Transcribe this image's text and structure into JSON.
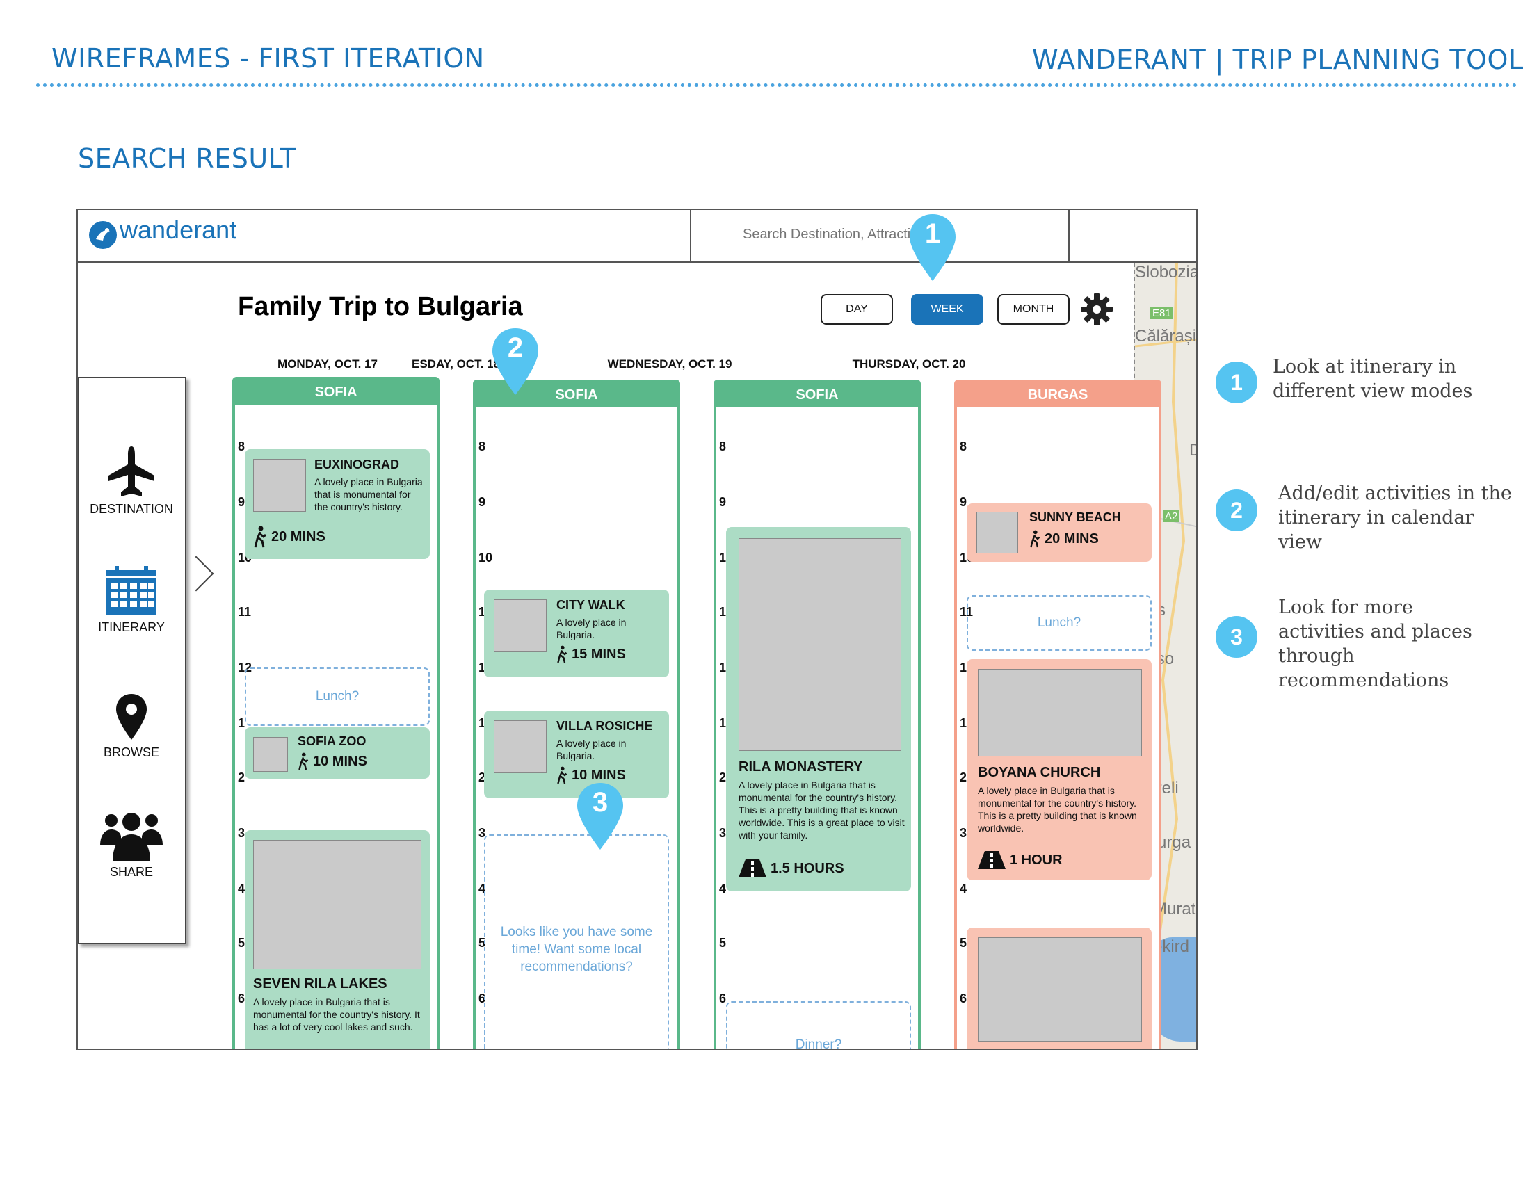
{
  "page": {
    "left_title": "WIREFRAMES - FIRST ITERATION",
    "right_title": "WANDERANT | TRIP PLANNING TOOL",
    "section_title": "SEARCH RESULT"
  },
  "app": {
    "logo_text": "wanderant",
    "search_placeholder": "Search Destination, Attraction, etc."
  },
  "trip": {
    "title": "Family Trip to Bulgaria"
  },
  "view_modes": [
    {
      "label": "DAY",
      "active": false
    },
    {
      "label": "WEEK",
      "active": true
    },
    {
      "label": "MONTH",
      "active": false
    }
  ],
  "sidebar": {
    "items": [
      {
        "label": "DESTINATION",
        "icon": "airplane-icon"
      },
      {
        "label": "ITINERARY",
        "icon": "calendar-icon"
      },
      {
        "label": "BROWSE",
        "icon": "map-pin-icon"
      },
      {
        "label": "SHARE",
        "icon": "people-icon"
      }
    ]
  },
  "hours": [
    "8",
    "9",
    "10",
    "11",
    "12",
    "1",
    "2",
    "3",
    "4",
    "5",
    "6"
  ],
  "days": [
    {
      "header": "MONDAY, OCT. 17",
      "city": "SOFIA",
      "color": "#5ab88a",
      "events": [
        {
          "title": "EUXINOGRAD",
          "desc": "A lovely place in Bulgaria that is monumental for the country's history.",
          "duration": "20 MINS"
        },
        {
          "placeholder": "Lunch?"
        },
        {
          "title": "SOFIA ZOO",
          "duration": "10 MINS"
        },
        {
          "title": "SEVEN RILA LAKES",
          "desc": "A lovely place in Bulgaria that is monumental for the country's history. It has a lot of very cool lakes and such."
        }
      ]
    },
    {
      "header": "TUESDAY, OCT. 18",
      "header_visible": "ESDAY, OCT. 18",
      "city": "SOFIA",
      "color": "#5ab88a",
      "events": [
        {
          "title": "CITY WALK",
          "desc": "A lovely place in Bulgaria.",
          "duration": "15 MINS"
        },
        {
          "title": "VILLA ROSICHE",
          "desc": "A lovely place in Bulgaria.",
          "duration": "10 MINS"
        },
        {
          "placeholder": "Looks like you have some time! Want some local recommendations?"
        }
      ]
    },
    {
      "header": "WEDNESDAY, OCT. 19",
      "city": "SOFIA",
      "color": "#5ab88a",
      "events": [
        {
          "title": "RILA MONASTERY",
          "desc": "A lovely place in Bulgaria that is monumental for the country's history. This is a pretty building that is known worldwide. This is a great place to visit with your family.",
          "duration": "1.5 HOURS"
        },
        {
          "placeholder": "Dinner?"
        }
      ]
    },
    {
      "header": "THURSDAY, OCT. 20",
      "city": "BURGAS",
      "color": "#f4a08a",
      "events": [
        {
          "title": "SUNNY BEACH",
          "duration": "20 MINS"
        },
        {
          "placeholder": "Lunch?"
        },
        {
          "title": "BOYANA CHURCH",
          "desc": "A lovely place in Bulgaria that is monumental for the country's history. This is a pretty building that is known worldwide.",
          "duration": "1 HOUR"
        }
      ]
    }
  ],
  "map_labels": [
    "Slobozia",
    "E81",
    "Călărași",
    "D",
    "A2",
    "ytos",
    "gaso",
    "klareli",
    "leburga",
    "Murat",
    "Tekird"
  ],
  "callouts": [
    {
      "number": "1",
      "text": "Look at itinerary in different view modes"
    },
    {
      "number": "2",
      "text": "Add/edit activities in the itinerary in calendar view"
    },
    {
      "number": "3",
      "text": "Look for more activities and places through recommendations"
    }
  ],
  "colors": {
    "brand_blue": "#1a73b8",
    "callout_blue": "#55c4f1",
    "sofia_green": "#5ab88a",
    "burgas_orange": "#f4a08a",
    "card_green": "#acdcc5",
    "card_orange": "#f9c3b3"
  }
}
